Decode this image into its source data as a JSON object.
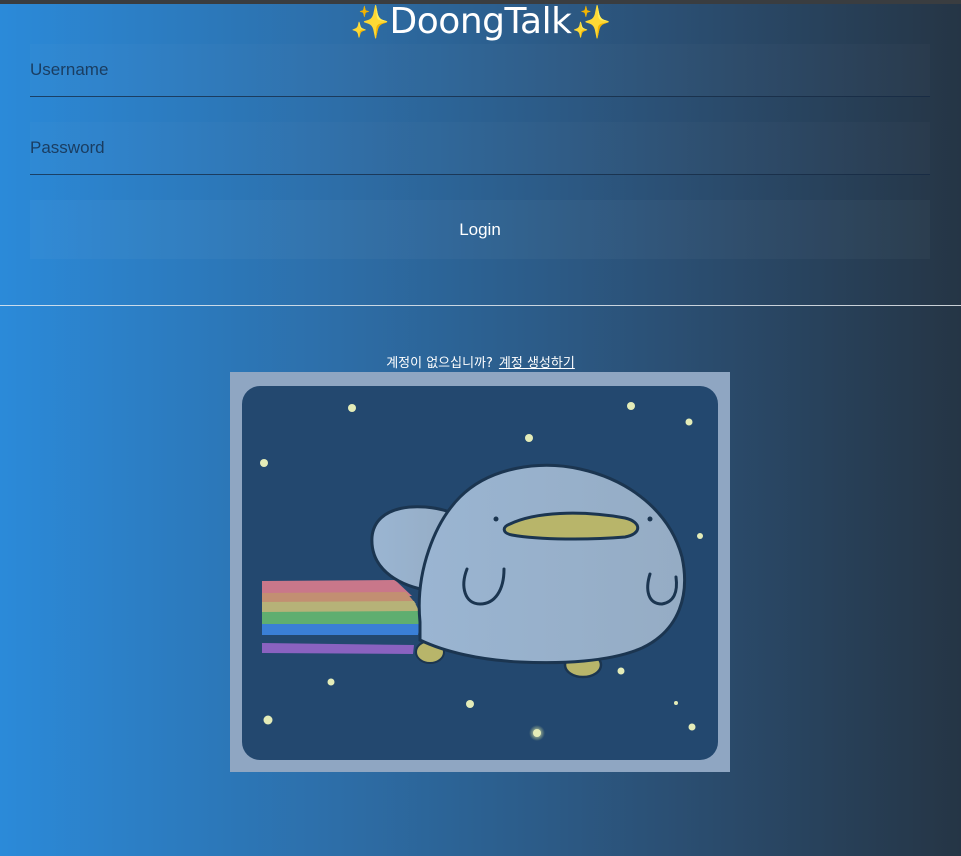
{
  "app": {
    "title": "DoongTalk",
    "title_decoration": "sparkles"
  },
  "login_form": {
    "username_placeholder": "Username",
    "username_value": "",
    "password_placeholder": "Password",
    "password_value": "",
    "login_label": "Login"
  },
  "signup": {
    "prompt": "계정이 없으십니까?",
    "link_label": "계정 생성하기"
  },
  "illustration": {
    "subject": "duck-billed mascot flying with rainbow trail in starry sky"
  },
  "colors": {
    "background_left": "#2b8ad9",
    "background_right": "#253545",
    "sparkle": "#f5d44a",
    "text": "#ffffff",
    "placeholder": "#16304e"
  }
}
